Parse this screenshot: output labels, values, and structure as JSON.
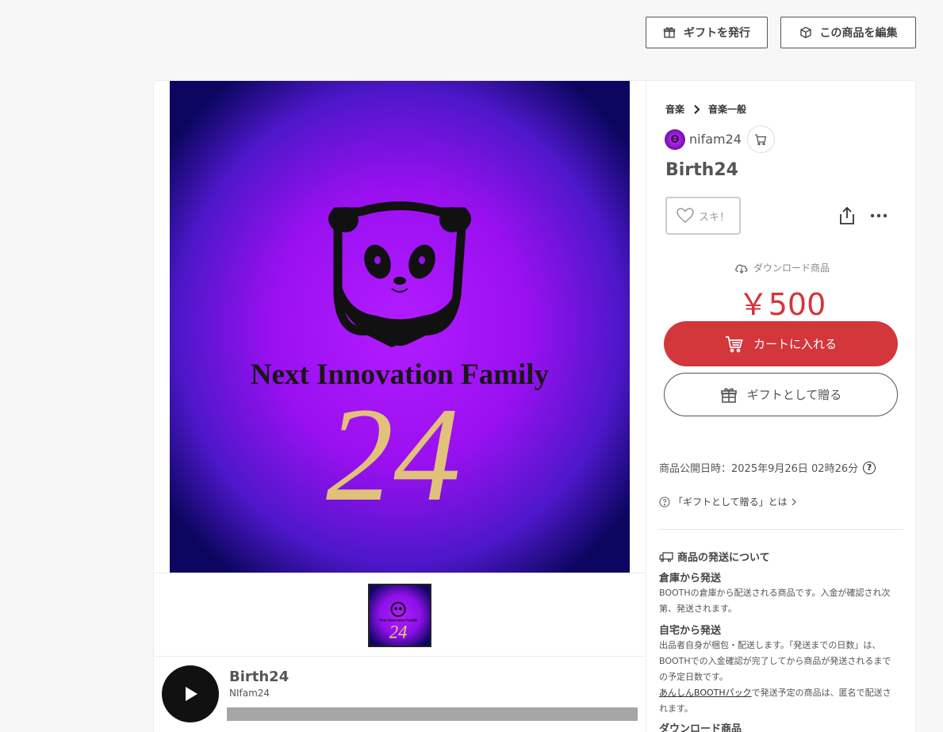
{
  "top_actions": {
    "gift_issue_label": "ギフトを発行",
    "edit_item_label": "この商品を編集"
  },
  "artwork": {
    "text_line1": "Next Innovation Family",
    "text_line2": "24"
  },
  "player": {
    "title": "Birth24",
    "artist": "NIfam24"
  },
  "breadcrumb": [
    "音楽",
    "音楽一般"
  ],
  "shop": {
    "name": "nifam24"
  },
  "item": {
    "title": "Birth24",
    "like_label": "スキ！",
    "type_label": "ダウンロード商品",
    "price": "￥500",
    "cart_label": "カートに入れる",
    "gift_label": "ギフトとして贈る"
  },
  "meta": {
    "published": "商品公開日時：2025年9月26日 02時26分",
    "gift_about": "「ギフトとして贈る」とは"
  },
  "shipping": {
    "heading": "商品の発送について",
    "warehouse_title": "倉庫から発送",
    "warehouse_text": "BOOTHの倉庫から配送される商品です。入金が確認され次第、発送されます。",
    "home_title": "自宅から発送",
    "home_text": "出品者自身が梱包・配送します。「発送までの日数」は、BOOTHでの入金確認が完了してから商品が発送されるまでの予定日数です。",
    "anshin_link": "あんしんBOOTHパック",
    "anshin_text": "で発送予定の商品は、匿名で配送されます。",
    "download_title": "ダウンロード商品"
  },
  "colors": {
    "accent_red": "#d3363b",
    "art_purple": "#9a10f0",
    "art_edge": "#1a0a78",
    "art_gold": "#e8d070"
  }
}
